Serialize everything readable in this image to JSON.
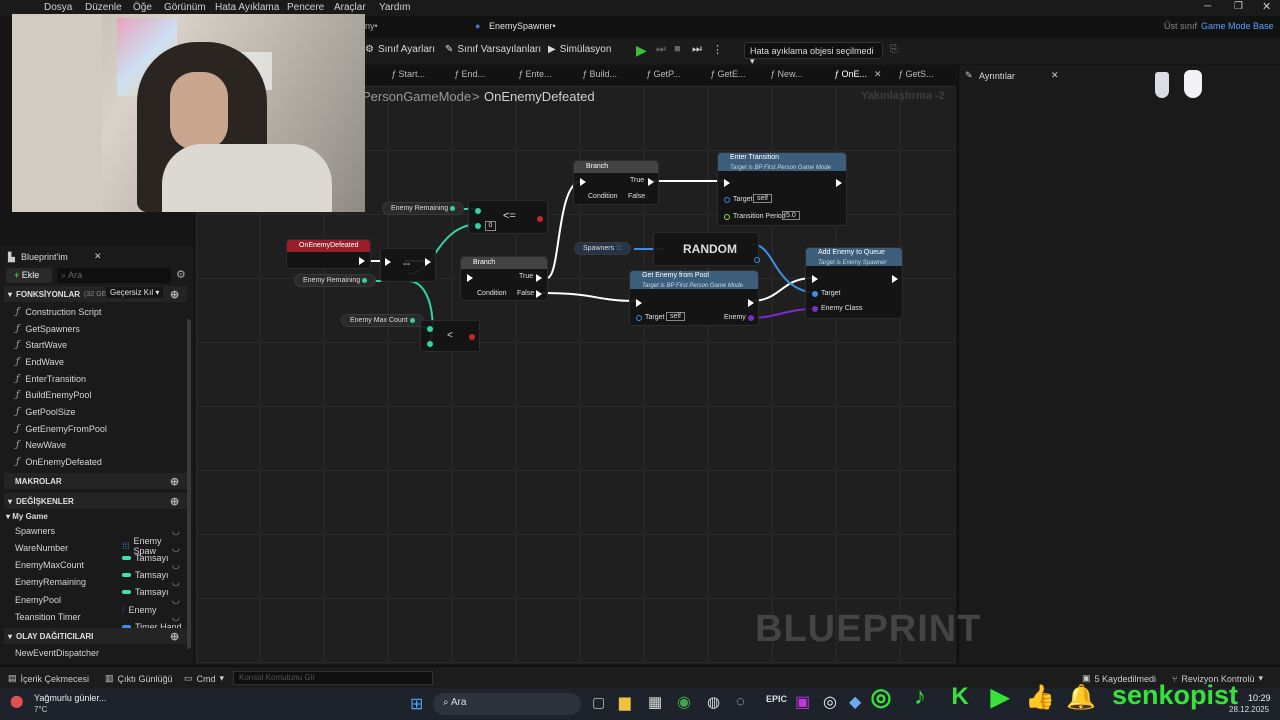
{
  "menu": [
    "Dosya",
    "Düzenle",
    "Öğe",
    "Görünüm",
    "Hata Ayıklama",
    "Pencere",
    "Araçlar",
    "Yardım"
  ],
  "title": {
    "asset_tab": "EnemySpawner•",
    "parent_label": "Üst sınıf",
    "parent_value": "Game Mode Base",
    "partial_left": "ny•"
  },
  "toolbar": {
    "class_settings": "Sınıf Ayarları",
    "class_defaults": "Sınıf Varsayılanları",
    "simulation": "Simülasyon",
    "debug_select": "Hata ayıklama objesi seçilmedi"
  },
  "graph_tabs": [
    "Start...",
    "End...",
    "Ente...",
    "Build...",
    "GetP...",
    "GetE...",
    "New...",
    "OnE...",
    "GetS..."
  ],
  "details_tab": "Ayrıntılar",
  "breadcrumb": {
    "parent": "PersonGameMode",
    "sep": ">",
    "current": "OnEnemyDefeated",
    "zoom": "Yakınlaştırma -2"
  },
  "left_panel": {
    "tab_title": "Blueprint'im",
    "add_button": "Ekle",
    "search_placeholder": "Ara",
    "functions_header": "FONKSİYONLAR",
    "functions_count": "(32 GEÇE",
    "override_dropdown": "Geçersiz Kıl",
    "functions": [
      "Construction Script",
      "GetSpawners",
      "StartWave",
      "EndWave",
      "EnterTransition",
      "BuildEnemyPool",
      "GetPoolSize",
      "GetEnemyFromPool",
      "NewWave",
      "OnEnemyDefeated"
    ],
    "macros_header": "MAKROLAR",
    "variables_header": "DEĞİŞKENLER",
    "category": "My Game",
    "variables": [
      {
        "name": "Spawners",
        "type": "Enemy Spaw",
        "color": "#3a8ee6"
      },
      {
        "name": "WareNumber",
        "type": "Tamsayı",
        "color": "#3de0b2"
      },
      {
        "name": "EnemyMaxCount",
        "type": "Tamsayı",
        "color": "#3de0b2"
      },
      {
        "name": "EnemyRemaining",
        "type": "Tamsayı",
        "color": "#3de0b2"
      },
      {
        "name": "EnemyPool",
        "type": "Enemy",
        "color": "#3a8ee6"
      },
      {
        "name": "Teansition Timer",
        "type": "Timer Hand",
        "color": "#3a8ee6"
      }
    ],
    "dispatchers_header": "OLAY DAĞITICILARI",
    "dispatchers": [
      "NewEventDispatcher"
    ]
  },
  "nodes": {
    "event": "OnEnemyDefeated",
    "enemy_remaining_1": "Enemy Remaining",
    "enemy_remaining_2": "Enemy Remaining",
    "enemy_max_count": "Enemy Max Count",
    "le_op": "<=",
    "le_value": "0",
    "lt_op": "<",
    "minusminus": "--",
    "branch1_title": "Branch",
    "branch1_true": "True",
    "branch1_false": "False",
    "branch1_condition": "Condition",
    "branch2_title": "Branch",
    "branch2_true": "True",
    "branch2_false": "False",
    "branch2_condition": "Condition",
    "enter_title": "Enter Transition",
    "enter_sub": "Target is BP First Person Game Mode",
    "enter_target": "Target",
    "enter_target_val": "self",
    "enter_period": "Transition Period",
    "enter_period_val": "5.0",
    "spawners": "Spawners",
    "random": "RANDOM",
    "pool_title": "Get Enemy from Pool",
    "pool_sub": "Target is BP First Person Game Mode",
    "pool_target": "Target",
    "pool_target_val": "self",
    "pool_enemy": "Enemy",
    "queue_title": "Add Enemy to Queue",
    "queue_sub": "Target is Enemy Spawner",
    "queue_target": "Target",
    "queue_class": "Enemy Class"
  },
  "watermark": "BLUEPRINT",
  "bottom": {
    "content_drawer": "İçerik Çekmecesi",
    "output_log": "Çıktı Günlüğü",
    "cmd": "Cmd",
    "console_placeholder": "Konsol Komutunu Gir",
    "saved": "5 Kaydedilmedi",
    "revision": "Revizyon Kontrolü"
  },
  "taskbar": {
    "weather_text": "Yağmurlu günler...",
    "temp": "7°C",
    "search": "Ara",
    "time": "10:29",
    "date": "28.12.2025"
  },
  "overlay": {
    "handle": "senkopist"
  }
}
